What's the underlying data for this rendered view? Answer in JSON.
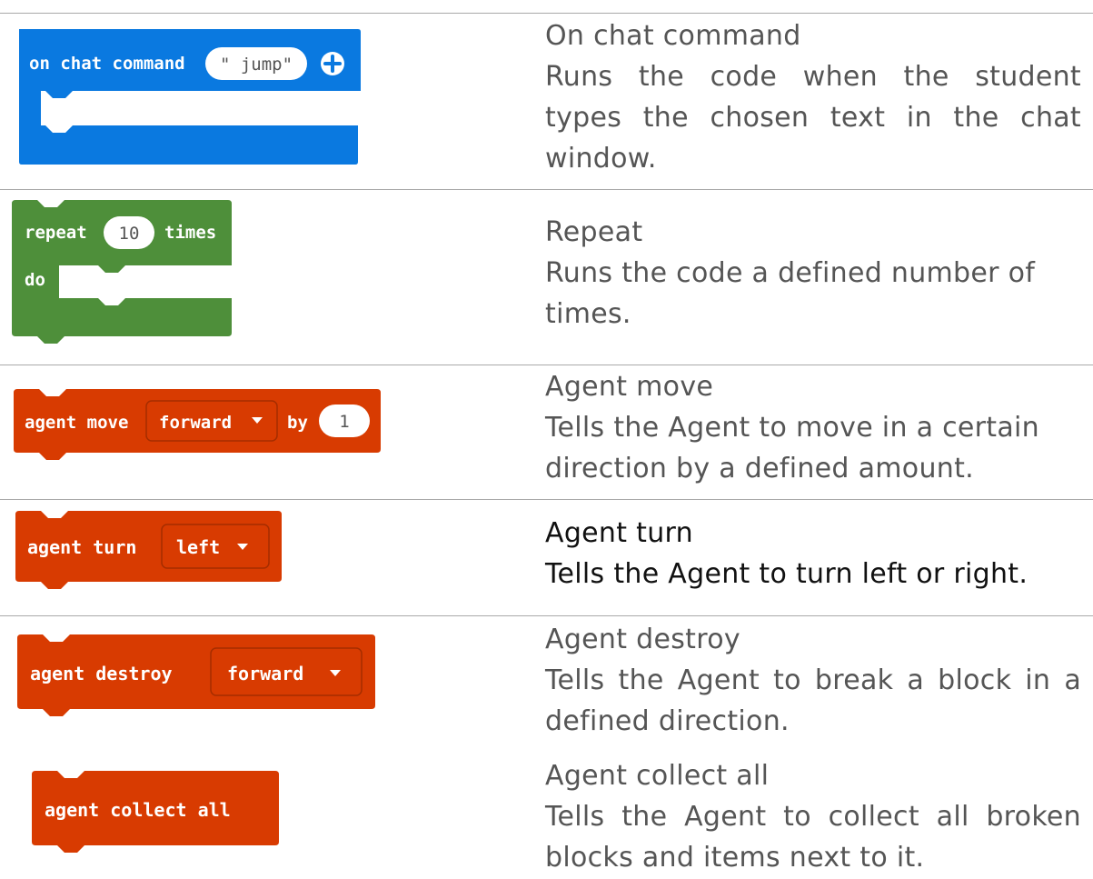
{
  "colors": {
    "events_blue": "#0a79e0",
    "loops_green": "#4e8f3a",
    "agent_orange": "#d83b01",
    "text_gray": "#555555",
    "text_dark": "#111111",
    "divider": "#a9a9a9"
  },
  "blocks": {
    "chat": {
      "label": "on chat command",
      "arg": "\" jump\"",
      "add_icon": "plus-circle-icon"
    },
    "repeat": {
      "label_start": "repeat",
      "count": "10",
      "label_end": "times",
      "do_label": "do"
    },
    "move": {
      "label": "agent move",
      "direction": "forward",
      "by_label": "by",
      "amount": "1",
      "dropdown_icon": "caret-down-icon"
    },
    "turn": {
      "label": "agent turn",
      "direction": "left"
    },
    "destroy": {
      "label": "agent destroy",
      "direction": "forward"
    },
    "collect": {
      "label": "agent collect all"
    }
  },
  "descriptions": {
    "chat": {
      "title": "On chat command",
      "text": "Runs the code when the student types the chosen text in the chat window."
    },
    "repeat": {
      "title": "Repeat",
      "text": "Runs the code a defined number of times."
    },
    "move": {
      "title": "Agent move",
      "text": "Tells the Agent to move in a certain direction by a defined amount."
    },
    "turn": {
      "title": "Agent turn",
      "text": "Tells the Agent to turn left or right."
    },
    "destroy": {
      "title": "Agent destroy",
      "text": "Tells the Agent to break a block in a defined direction."
    },
    "collect": {
      "title": "Agent collect all",
      "text": "Tells the Agent to collect all broken blocks and items next to it."
    }
  }
}
